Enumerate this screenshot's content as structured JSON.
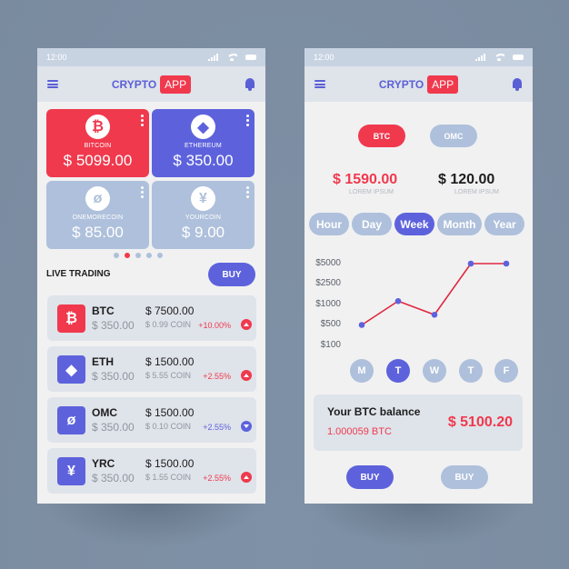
{
  "colors": {
    "red": "#f0394d",
    "purple": "#5d62dc",
    "light_blue": "#aec0db",
    "line": "#e0283f"
  },
  "status_bar": {
    "time": "12:00"
  },
  "header": {
    "brand_text": "CRYPTO",
    "brand_badge": "APP"
  },
  "left": {
    "cards": [
      {
        "name": "BITCOIN",
        "value": "$ 5099.00",
        "icon": "bitcoin-icon",
        "glyph": "₿",
        "color": "#f0394d"
      },
      {
        "name": "ETHEREUM",
        "value": "$ 350.00",
        "icon": "ethereum-icon",
        "glyph": "◆",
        "color": "#5d62dc"
      },
      {
        "name": "ONEMORECOIN",
        "value": "$ 85.00",
        "icon": "onemorecoin-icon",
        "glyph": "ø",
        "color": "#aec0db"
      },
      {
        "name": "YOURCOIN",
        "value": "$ 9.00",
        "icon": "yourcoin-icon",
        "glyph": "¥",
        "color": "#aec0db"
      }
    ],
    "pager": {
      "count": 5,
      "active_index": 1
    },
    "live_trading_title": "LIVE TRADING",
    "buy_label": "BUY",
    "trades": [
      {
        "symbol": "BTC",
        "holding": "$ 350.00",
        "price": "$ 7500.00",
        "coin": "$ 0.99 COIN",
        "change": "+10.00%",
        "direction": "up",
        "glyph": "₿",
        "icon_color": "#f0394d",
        "change_color": "#f0394d"
      },
      {
        "symbol": "ETH",
        "holding": "$ 350.00",
        "price": "$ 1500.00",
        "coin": "$ 5.55 COIN",
        "change": "+2.55%",
        "direction": "up",
        "glyph": "◆",
        "icon_color": "#5d62dc",
        "change_color": "#f0394d"
      },
      {
        "symbol": "OMC",
        "holding": "$ 350.00",
        "price": "$ 1500.00",
        "coin": "$ 0.10 COIN",
        "change": "+2.55%",
        "direction": "down",
        "glyph": "ø",
        "icon_color": "#5d62dc",
        "change_color": "#5d62dc"
      },
      {
        "symbol": "YRC",
        "holding": "$ 350.00",
        "price": "$ 1500.00",
        "coin": "$ 1.55 COIN",
        "change": "+2.55%",
        "direction": "up",
        "glyph": "¥",
        "icon_color": "#5d62dc",
        "change_color": "#f0394d"
      }
    ]
  },
  "right": {
    "coin_tabs": [
      {
        "label": "BTC",
        "active": true
      },
      {
        "label": "OMC",
        "active": false
      }
    ],
    "values": [
      {
        "amount": "$ 1590.00",
        "caption": "LOREM IPSUM"
      },
      {
        "amount": "$ 120.00",
        "caption": "LOREM IPSUM"
      }
    ],
    "ranges": [
      {
        "label": "Hour",
        "active": false
      },
      {
        "label": "Day",
        "active": false
      },
      {
        "label": "Week",
        "active": true
      },
      {
        "label": "Month",
        "active": false
      },
      {
        "label": "Year",
        "active": false
      }
    ],
    "chart": {
      "type": "line",
      "y_tick_labels": [
        "$5000",
        "$2500",
        "$1000",
        "$500",
        "$100"
      ],
      "x_labels": [
        "M",
        "T",
        "W",
        "T",
        "F"
      ],
      "active_day_index": 1,
      "values": [
        500,
        1250,
        750,
        5000,
        5000
      ]
    },
    "balance": {
      "title": "Your BTC balance",
      "btc_amount": "1.000059 BTC",
      "usd_amount": "$ 5100.20"
    },
    "buy_buttons": [
      {
        "label": "BUY",
        "active": true
      },
      {
        "label": "BUY",
        "active": false
      }
    ]
  },
  "chart_data": {
    "type": "line",
    "title": "",
    "xlabel": "",
    "ylabel": "",
    "categories": [
      "M",
      "T",
      "W",
      "T",
      "F"
    ],
    "series": [
      {
        "name": "BTC",
        "values": [
          500,
          1250,
          750,
          5000,
          5000
        ]
      }
    ],
    "y_ticks": [
      100,
      500,
      1000,
      2500,
      5000
    ],
    "y_scale": "ordinal-tick",
    "ylim": [
      100,
      5000
    ],
    "grid": false
  }
}
